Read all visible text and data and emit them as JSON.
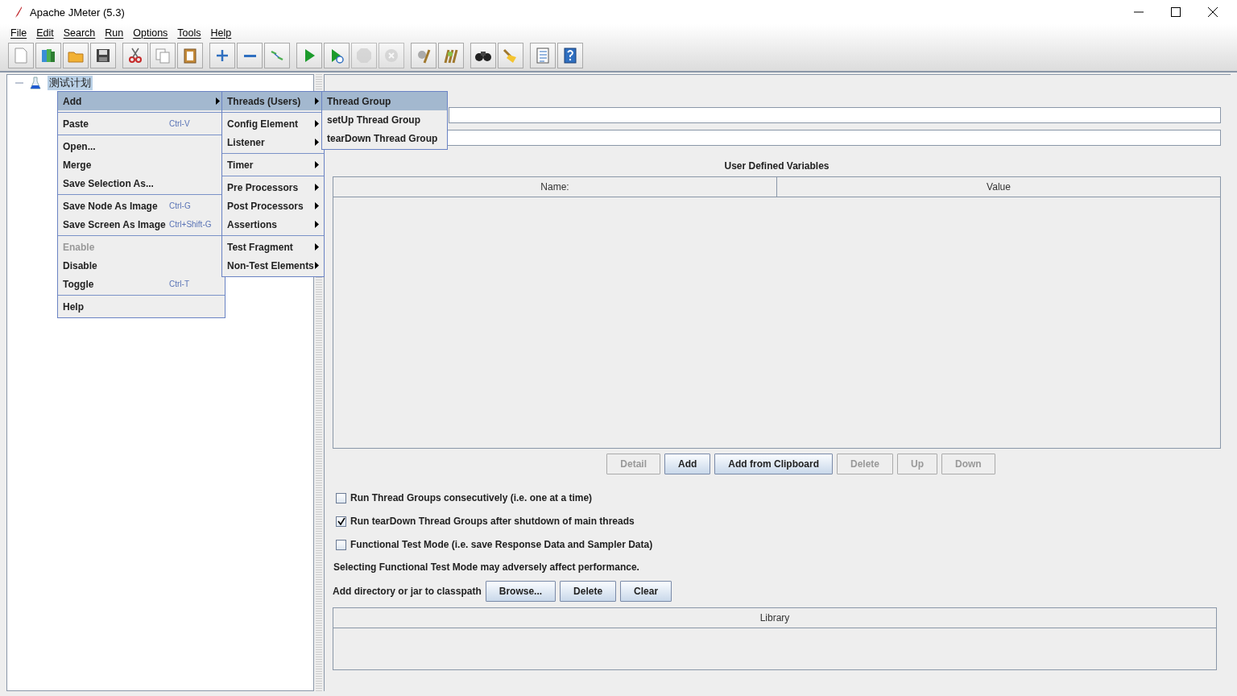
{
  "window": {
    "title": "Apache JMeter (5.3)"
  },
  "menu_bar": [
    "File",
    "Edit",
    "Search",
    "Run",
    "Options",
    "Tools",
    "Help"
  ],
  "toolbar": [
    [
      {
        "kind": "new",
        "disabled": false
      },
      {
        "kind": "templates",
        "disabled": false
      },
      {
        "kind": "open",
        "disabled": false
      },
      {
        "kind": "save",
        "disabled": false
      }
    ],
    [
      {
        "kind": "cut",
        "disabled": false
      },
      {
        "kind": "copy",
        "disabled": false
      },
      {
        "kind": "paste",
        "disabled": false
      }
    ],
    [
      {
        "kind": "expand",
        "disabled": false
      },
      {
        "kind": "collapse",
        "disabled": false
      },
      {
        "kind": "toggle",
        "disabled": false
      }
    ],
    [
      {
        "kind": "start",
        "disabled": false
      },
      {
        "kind": "start-no-pause",
        "disabled": false
      },
      {
        "kind": "stop",
        "disabled": true
      },
      {
        "kind": "shutdown",
        "disabled": true
      }
    ],
    [
      {
        "kind": "clear",
        "disabled": false
      },
      {
        "kind": "clear-all",
        "disabled": false
      }
    ],
    [
      {
        "kind": "search",
        "disabled": false
      },
      {
        "kind": "reset-search",
        "disabled": false
      }
    ],
    [
      {
        "kind": "function-helper",
        "disabled": false
      },
      {
        "kind": "help",
        "disabled": false
      }
    ]
  ],
  "tree": {
    "items": [
      {
        "label": "测试计划",
        "selected": true,
        "expanded": true
      }
    ]
  },
  "context_menu": {
    "groups": [
      [
        {
          "label": "Add",
          "selected": true,
          "disabled": false,
          "submenu": true
        }
      ],
      [
        {
          "label": "Paste",
          "shortcut": "Ctrl-V",
          "selected": false,
          "disabled": false,
          "submenu": false
        }
      ],
      [
        {
          "label": "Open...",
          "selected": false,
          "disabled": false,
          "submenu": false
        },
        {
          "label": "Merge",
          "selected": false,
          "disabled": false,
          "submenu": false
        },
        {
          "label": "Save Selection As...",
          "selected": false,
          "disabled": false,
          "submenu": false
        }
      ],
      [
        {
          "label": "Save Node As Image",
          "shortcut": "Ctrl-G",
          "selected": false,
          "disabled": false,
          "submenu": false
        },
        {
          "label": "Save Screen As Image",
          "shortcut": "Ctrl+Shift-G",
          "selected": false,
          "disabled": false,
          "submenu": false
        }
      ],
      [
        {
          "label": "Enable",
          "selected": false,
          "disabled": true,
          "submenu": false
        },
        {
          "label": "Disable",
          "selected": false,
          "disabled": false,
          "submenu": false
        },
        {
          "label": "Toggle",
          "shortcut": "Ctrl-T",
          "selected": false,
          "disabled": false,
          "submenu": false
        }
      ],
      [
        {
          "label": "Help",
          "selected": false,
          "disabled": false,
          "submenu": false
        }
      ]
    ]
  },
  "add_submenu": {
    "groups": [
      [
        {
          "label": "Threads (Users)",
          "selected": true,
          "submenu": true
        }
      ],
      [
        {
          "label": "Config Element",
          "selected": false,
          "submenu": true
        },
        {
          "label": "Listener",
          "selected": false,
          "submenu": true
        }
      ],
      [
        {
          "label": "Timer",
          "selected": false,
          "submenu": true
        }
      ],
      [
        {
          "label": "Pre Processors",
          "selected": false,
          "submenu": true
        },
        {
          "label": "Post Processors",
          "selected": false,
          "submenu": true
        },
        {
          "label": "Assertions",
          "selected": false,
          "submenu": true
        }
      ],
      [
        {
          "label": "Test Fragment",
          "selected": false,
          "submenu": true
        },
        {
          "label": "Non-Test Elements",
          "selected": false,
          "submenu": true
        }
      ]
    ]
  },
  "threads_submenu": {
    "items": [
      {
        "label": "Thread Group",
        "selected": true
      },
      {
        "label": "setUp Thread Group",
        "selected": false
      },
      {
        "label": "tearDown Thread Group",
        "selected": false
      }
    ]
  },
  "variables": {
    "title": "User Defined Variables",
    "columns": [
      "Name:",
      "Value"
    ]
  },
  "variable_buttons": [
    {
      "label": "Detail",
      "disabled": true
    },
    {
      "label": "Add",
      "disabled": false
    },
    {
      "label": "Add from Clipboard",
      "disabled": false
    },
    {
      "label": "Delete",
      "disabled": true
    },
    {
      "label": "Up",
      "disabled": true
    },
    {
      "label": "Down",
      "disabled": true
    }
  ],
  "options": [
    {
      "label": "Run Thread Groups consecutively (i.e. one at a time)",
      "checked": false
    },
    {
      "label": "Run tearDown Thread Groups after shutdown of main threads",
      "checked": true
    },
    {
      "label": "Functional Test Mode (i.e. save Response Data and Sampler Data)",
      "checked": false
    }
  ],
  "note": "Selecting Functional Test Mode may adversely affect performance.",
  "classpath": {
    "label": "Add directory or jar to classpath",
    "buttons": [
      {
        "label": "Browse...",
        "disabled": false
      },
      {
        "label": "Delete",
        "disabled": false
      },
      {
        "label": "Clear",
        "disabled": false
      }
    ],
    "columns": [
      "Library"
    ]
  }
}
